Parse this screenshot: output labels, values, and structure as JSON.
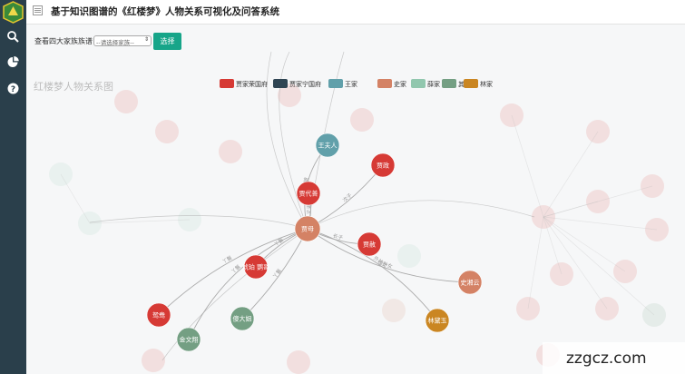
{
  "header": {
    "title": "基于知识图谱的《红楼梦》人物关系可视化及问答系统"
  },
  "sidebar": {
    "items": [
      {
        "icon": "search-icon"
      },
      {
        "icon": "pie-chart-icon"
      },
      {
        "icon": "help-icon"
      }
    ]
  },
  "filter": {
    "label": "查看四大家族族谱",
    "placeholder": "--请选择家族--",
    "button": "选择"
  },
  "chart": {
    "title": "红楼梦人物关系图",
    "legend": [
      {
        "name": "贾家荣国府",
        "color": "#d63a35"
      },
      {
        "name": "贾家宁国府",
        "color": "#2f4553"
      },
      {
        "name": "王家",
        "color": "#61a0aa"
      },
      {
        "name": "史家",
        "color": "#d48265"
      },
      {
        "name": "薛家",
        "color": "#91c7ae"
      },
      {
        "name": "其他",
        "color": "#749f83"
      },
      {
        "name": "林家",
        "color": "#ca8622"
      }
    ],
    "nodes": [
      {
        "id": "jiamu",
        "label": "贾母",
        "family": "史家"
      },
      {
        "id": "wangfuren",
        "label": "王夫人",
        "family": "王家"
      },
      {
        "id": "jiazheng",
        "label": "贾政",
        "family": "贾家荣国府"
      },
      {
        "id": "jiadaishan",
        "label": "贾代善",
        "family": "贾家荣国府"
      },
      {
        "id": "jiashe",
        "label": "贾赦",
        "family": "贾家荣国府"
      },
      {
        "id": "shixiangyun",
        "label": "史湘云",
        "family": "史家"
      },
      {
        "id": "linhaiyu",
        "label": "林黛玉",
        "family": "林家"
      },
      {
        "id": "hupo",
        "label": "琥珀 鹦哥",
        "family": "贾家荣国府"
      },
      {
        "id": "yuanyang",
        "label": "鸳鸯",
        "family": "贾家荣国府"
      },
      {
        "id": "shadajie",
        "label": "傻大姐",
        "family": "其他"
      },
      {
        "id": "jinwenxiang",
        "label": "金文翔",
        "family": "其他"
      }
    ],
    "edges": [
      {
        "source": "jiamu",
        "target": "wangfuren",
        "label": "儿媳"
      },
      {
        "source": "jiamu",
        "target": "jiazheng",
        "label": "次子"
      },
      {
        "source": "jiamu",
        "target": "jiadaishan",
        "label": "丈夫"
      },
      {
        "source": "jiamu",
        "target": "jiashe",
        "label": "长子"
      },
      {
        "source": "jiamu",
        "target": "shixiangyun",
        "label": "侄孙女"
      },
      {
        "source": "jiamu",
        "target": "linhaiyu",
        "label": "外孙女"
      },
      {
        "source": "jiamu",
        "target": "hupo",
        "label": "丫鬟"
      },
      {
        "source": "jiamu",
        "target": "yuanyang",
        "label": "丫鬟"
      },
      {
        "source": "jiamu",
        "target": "shadajie",
        "label": "丫鬟"
      },
      {
        "source": "jiamu",
        "target": "jinwenxiang",
        "label": "丫鬟"
      }
    ]
  },
  "watermark": "zzgcz.com"
}
